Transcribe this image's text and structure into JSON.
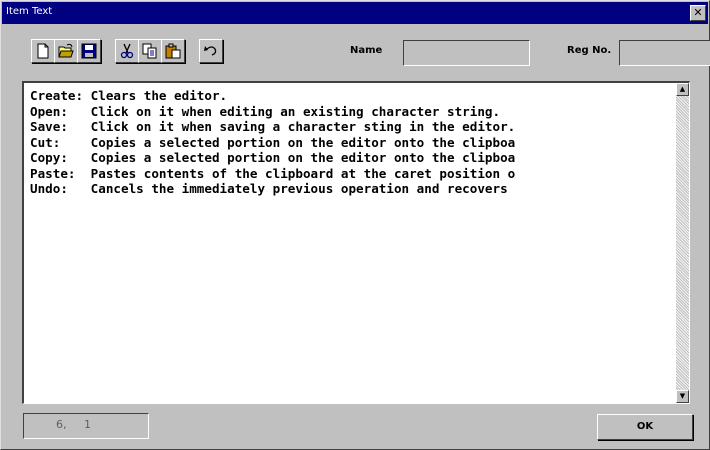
{
  "window": {
    "title": "Item Text",
    "close_glyph": "✕"
  },
  "toolbar": {
    "buttons": [
      {
        "id": "create",
        "icon": "new-document-icon"
      },
      {
        "id": "open",
        "icon": "open-folder-icon"
      },
      {
        "id": "save",
        "icon": "floppy-disk-icon"
      },
      {
        "id": "cut",
        "icon": "scissors-icon"
      },
      {
        "id": "copy",
        "icon": "copy-icon"
      },
      {
        "id": "paste",
        "icon": "clipboard-icon"
      },
      {
        "id": "undo",
        "icon": "undo-arrow-icon"
      }
    ]
  },
  "fields": {
    "name_label": "Name",
    "name_value": "",
    "reg_label": "Reg No.",
    "reg_value": ""
  },
  "editor": {
    "lines": [
      "Create: Clears the editor.",
      "Open:   Click on it when editing an existing character string.",
      "Save:   Click on it when saving a character sting in the editor.",
      "Cut:    Copies a selected portion on the editor onto the clipboa",
      "Copy:   Copies a selected portion on the editor onto the clipboa",
      "Paste:  Pastes contents of the clipboard at the caret position o",
      "Undo:   Cancels the immediately previous operation and recovers"
    ]
  },
  "status": {
    "line": "6,",
    "col": "1"
  },
  "ok_button": {
    "label": "OK"
  },
  "colors": {
    "titlebar": "#000080",
    "face": "#c0c0c0"
  }
}
